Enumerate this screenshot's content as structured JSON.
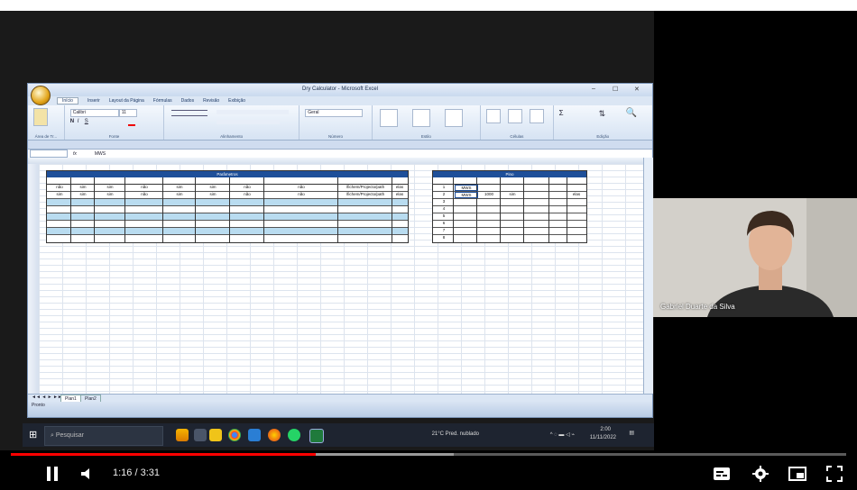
{
  "excel": {
    "title": "Dry Calculator - Microsoft Excel",
    "tabs": [
      "Início",
      "Inserir",
      "Layout da Página",
      "Fórmulas",
      "Dados",
      "Revisão",
      "Exibição"
    ],
    "active_tab": "Início",
    "ribbon_groups": [
      "Área de Tr...",
      "Fonte",
      "Alinhamento",
      "Número",
      "Estilo",
      "Células",
      "Edição"
    ],
    "font_name": "Calibri",
    "font_size": "11",
    "number_format": "Geral",
    "name_box": "",
    "formula_value": "MWS",
    "sheet_tabs": [
      "Plan1",
      "Plan2"
    ],
    "status_text": "Pronto",
    "tables": {
      "left_header": "Parâmetros",
      "left_rows": [
        [
          "não",
          "sim",
          "sim",
          "não",
          "sim",
          "sim",
          "não",
          "não",
          "/fichem/Projecto/path",
          "elas"
        ],
        [
          "sim",
          "sim",
          "sim",
          "não",
          "sim",
          "sim",
          "não",
          "não",
          "/fichem/Projecto/path",
          "elas"
        ]
      ],
      "right_header": "Pino",
      "right_index": [
        "1",
        "2",
        "3",
        "4",
        "5",
        "6",
        "7",
        "8"
      ],
      "right_rows": [
        [
          "MWS",
          "",
          "",
          "",
          "",
          ""
        ],
        [
          "MWS",
          "1000",
          "sim",
          "",
          "",
          "elas"
        ]
      ]
    }
  },
  "taskbar": {
    "search_placeholder": "Pesquisar",
    "weather": "21°C  Pred. nublado",
    "clock_time": "2:00",
    "clock_date": "11/11/2022"
  },
  "webcam": {
    "name": "Gabriel Duarte da Silva"
  },
  "player": {
    "current_time": "1:16",
    "duration": "3:31",
    "time_display": "1:16 / 3:31",
    "progress_fraction": 0.365,
    "buffer_fraction": 0.53
  },
  "colors": {
    "progress": "#ff0000",
    "table_header": "#1e4f99"
  }
}
